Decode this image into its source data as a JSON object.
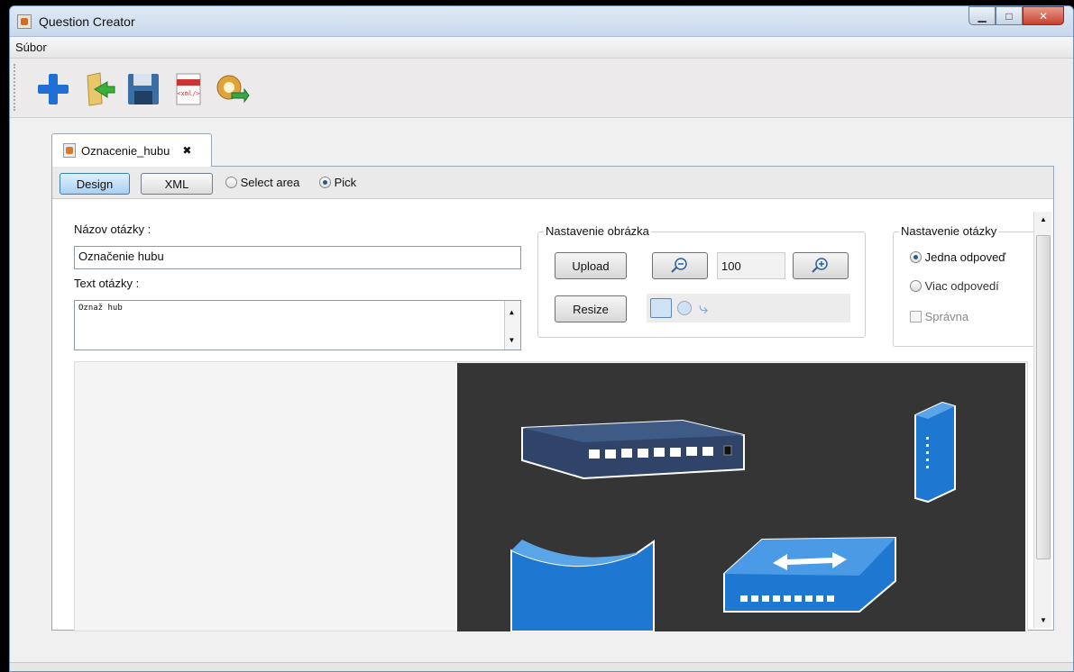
{
  "window": {
    "title": "Question Creator",
    "min_icon": "▁",
    "max_icon": "□",
    "close_icon": "✕"
  },
  "menu": {
    "file": "Súbor"
  },
  "toolbar": {
    "icons": [
      "add-icon",
      "open-folder-icon",
      "save-icon",
      "xml-export-icon",
      "import-icon"
    ]
  },
  "tab": {
    "label": "Oznacenie_hubu",
    "close": "✖"
  },
  "modebar": {
    "design": "Design",
    "xml": "XML",
    "select_area": "Select area",
    "pick": "Pick",
    "selected": "pick"
  },
  "form": {
    "name_label": "Názov otázky :",
    "name_value": "Označenie hubu",
    "text_label": "Text otázky :",
    "text_value": "Oznaž hub"
  },
  "image_settings": {
    "title": "Nastavenie obrázka",
    "upload": "Upload",
    "resize": "Resize",
    "zoom": "100"
  },
  "question_settings": {
    "title": "Nastavenie otázky",
    "single": "Jedna odpoveď",
    "multiple": "Viac odpovedí",
    "correct": "Správna",
    "selected": "single"
  },
  "canvas": {
    "background": "#353535",
    "device_color": "#1e78d2"
  }
}
